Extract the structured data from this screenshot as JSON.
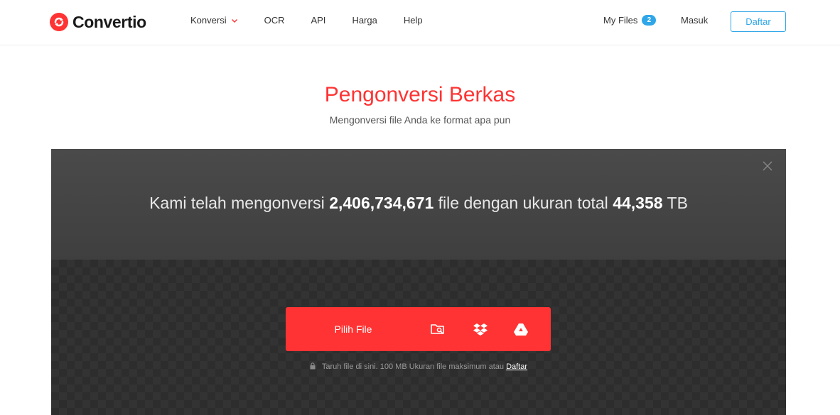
{
  "brand": {
    "name": "Convertio",
    "color": "#ff3333"
  },
  "nav": {
    "items": [
      {
        "label": "Konversi",
        "has_dropdown": true
      },
      {
        "label": "OCR"
      },
      {
        "label": "API"
      },
      {
        "label": "Harga"
      },
      {
        "label": "Help"
      }
    ],
    "my_files": {
      "label": "My Files",
      "count": "2"
    },
    "login": "Masuk",
    "register": "Daftar"
  },
  "hero": {
    "title": "Pengonversi Berkas",
    "subtitle": "Mengonversi file Anda ke format apa pun"
  },
  "stats": {
    "prefix": "Kami telah mengonversi",
    "files_count": "2,406,734,671",
    "middle": "file dengan ukuran total",
    "total_size": "44,358",
    "unit": "TB"
  },
  "upload": {
    "choose_label": "Pilih File",
    "sources": [
      "folder-search-icon",
      "dropbox-icon",
      "google-drive-icon"
    ],
    "note_text": "Taruh file di sini. 100 MB Ukuran file maksimum atau",
    "note_link": "Daftar"
  },
  "colors": {
    "accent": "#ff3333",
    "link_blue": "#2fa6e8",
    "panel_dark": "#3c3c3c"
  }
}
